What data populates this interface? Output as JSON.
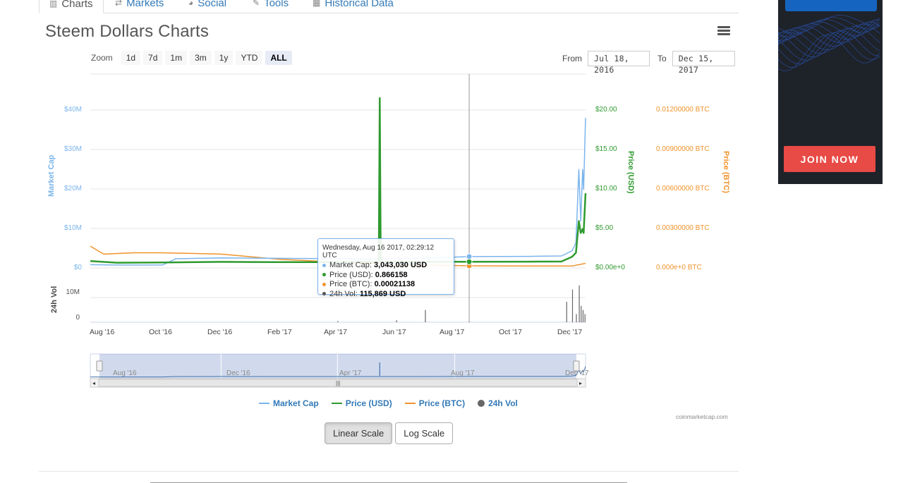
{
  "tabs": [
    {
      "label": "Charts",
      "icon": "bar-chart-icon"
    },
    {
      "label": "Markets",
      "icon": "exchange-icon"
    },
    {
      "label": "Social",
      "icon": "globe-icon"
    },
    {
      "label": "Tools",
      "icon": "wrench-icon"
    },
    {
      "label": "Historical Data",
      "icon": "table-icon"
    }
  ],
  "chart": {
    "title": "Steem Dollars Charts",
    "zoom_label": "Zoom",
    "zoom_options": [
      "1d",
      "7d",
      "1m",
      "3m",
      "1y",
      "YTD",
      "ALL"
    ],
    "zoom_selected": "ALL",
    "from_label": "From",
    "from_value": "Jul 18, 2016",
    "to_label": "To",
    "to_value": "Dec 15, 2017",
    "credit": "coinmarketcap.com",
    "scale_buttons": [
      "Linear Scale",
      "Log Scale"
    ],
    "scale_selected": "Linear Scale"
  },
  "tooltip": {
    "date": "Wednesday, Aug 16 2017, 02:29:12 UTC",
    "rows": [
      {
        "label": "Market Cap:",
        "value": "3,043,030 USD",
        "color": "#7cb5ec"
      },
      {
        "label": "Price (USD):",
        "value": "0.866158",
        "color": "#2f9a2f"
      },
      {
        "label": "Price (BTC):",
        "value": "0.00021138",
        "color": "#f0932b"
      },
      {
        "label": "24h Vol:",
        "value": "115,869 USD",
        "color": "#555555"
      }
    ]
  },
  "chart_data": {
    "type": "line",
    "axes": {
      "market_cap": {
        "title": "Market Cap",
        "ticks": [
          "$40M",
          "$30M",
          "$20M",
          "$10M",
          "$0"
        ],
        "range": [
          0,
          40000000
        ]
      },
      "price_usd": {
        "title": "Price (USD)",
        "ticks": [
          "$20.00",
          "$15.00",
          "$10.00",
          "$5.00",
          "$0.00e+0"
        ],
        "range": [
          0,
          20
        ]
      },
      "price_btc": {
        "title": "Price (BTC)",
        "ticks": [
          "0.01200000 BTC",
          "0.00900000 BTC",
          "0.00600000 BTC",
          "0.00300000 BTC",
          "0.000e+0 BTC"
        ],
        "range": [
          0,
          0.012
        ]
      },
      "volume": {
        "title": "24h Vol",
        "ticks": [
          "10M",
          "0"
        ]
      }
    },
    "x_ticks": [
      "Aug '16",
      "Oct '16",
      "Dec '16",
      "Feb '17",
      "Apr '17",
      "Jun '17",
      "Aug '17",
      "Oct '17",
      "Dec '17"
    ],
    "navigator_ticks": [
      "Aug '16",
      "Dec '16",
      "Apr '17",
      "Aug '17",
      "Dec '17"
    ],
    "series": [
      {
        "name": "Market Cap",
        "color": "#7cb5ec",
        "x": [
          "2016-07-18",
          "2016-08-15",
          "2016-09-15",
          "2016-10-01",
          "2016-10-15",
          "2016-12-01",
          "2017-02-01",
          "2017-04-01",
          "2017-05-15",
          "2017-05-20",
          "2017-06-15",
          "2017-08-16",
          "2017-10-15",
          "2017-11-20",
          "2017-12-01",
          "2017-12-05",
          "2017-12-08",
          "2017-12-10",
          "2017-12-12",
          "2017-12-13",
          "2017-12-15"
        ],
        "values": [
          1000000,
          900000,
          900000,
          900000,
          2500000,
          2700000,
          2600000,
          2500000,
          2400000,
          2500000,
          2500000,
          3043030,
          3100000,
          3200000,
          4500000,
          6500000,
          25000000,
          12000000,
          25000000,
          20000000,
          38000000
        ]
      },
      {
        "name": "Price (USD)",
        "color": "#2f9a2f",
        "x": [
          "2016-07-18",
          "2016-08-15",
          "2016-10-01",
          "2016-12-01",
          "2017-02-01",
          "2017-04-01",
          "2017-05-14",
          "2017-05-15",
          "2017-05-16",
          "2017-05-20",
          "2017-06-15",
          "2017-08-16",
          "2017-10-15",
          "2017-11-20",
          "2017-12-01",
          "2017-12-05",
          "2017-12-08",
          "2017-12-10",
          "2017-12-12",
          "2017-12-13",
          "2017-12-15"
        ],
        "values": [
          0.95,
          0.75,
          0.78,
          0.85,
          0.82,
          0.83,
          0.85,
          21.5,
          0.9,
          0.88,
          0.87,
          0.866158,
          0.88,
          0.9,
          1.5,
          2.0,
          6.0,
          4.5,
          5.0,
          4.5,
          9.5
        ]
      },
      {
        "name": "Price (BTC)",
        "color": "#f0932b",
        "x": [
          "2016-07-18",
          "2016-08-01",
          "2016-09-01",
          "2016-10-01",
          "2016-12-01",
          "2017-02-01",
          "2017-04-01",
          "2017-05-14",
          "2017-05-15",
          "2017-05-16",
          "2017-06-15",
          "2017-08-16",
          "2017-10-15",
          "2017-12-01",
          "2017-12-15"
        ],
        "values": [
          0.0017,
          0.0011,
          0.0012,
          0.0012,
          0.0011,
          0.0007,
          0.0005,
          0.0004,
          0.0128,
          0.0003,
          0.0003,
          0.00021138,
          0.0002,
          0.0002,
          0.0004
        ]
      },
      {
        "name": "24h Vol",
        "color": "#666666",
        "x": [
          "2017-04-01",
          "2017-06-01",
          "2017-07-01",
          "2017-08-16",
          "2017-11-25",
          "2017-12-01",
          "2017-12-05",
          "2017-12-08",
          "2017-12-10",
          "2017-12-12",
          "2017-12-14"
        ],
        "values": [
          300000,
          500000,
          3000000,
          115869,
          5000000,
          8000000,
          2000000,
          9000000,
          4000000,
          3000000,
          2000000
        ]
      }
    ],
    "ad": {
      "cta": "JOIN NOW"
    }
  }
}
